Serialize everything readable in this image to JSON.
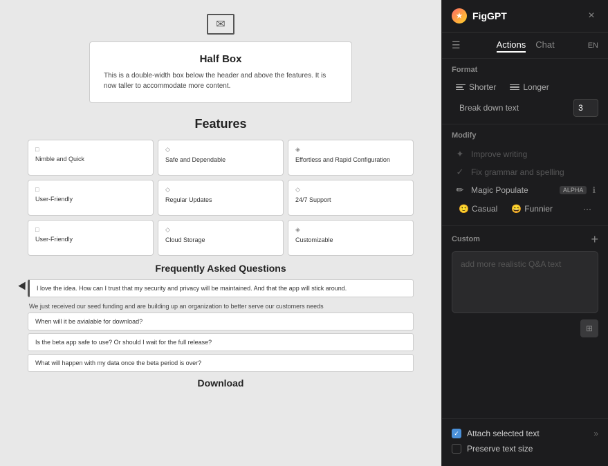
{
  "canvas": {
    "halfbox": {
      "title": "Half Box",
      "description": "This is a double-width box below the header and above the features.\nIt is now taller to accommodate more content."
    },
    "features": {
      "title": "Features",
      "cards": [
        {
          "icon": "□",
          "label": "Nimble and Quick"
        },
        {
          "icon": "◇",
          "label": "Safe and Dependable"
        },
        {
          "icon": "◈",
          "label": "Effortless and Rapid Configuration"
        },
        {
          "icon": "□",
          "label": "User-Friendly"
        },
        {
          "icon": "◇",
          "label": "Regular Updates"
        },
        {
          "icon": "◇",
          "label": "24/7 Support"
        },
        {
          "icon": "□",
          "label": "User-Friendly"
        },
        {
          "icon": "◇",
          "label": "Cloud Storage"
        },
        {
          "icon": "◈",
          "label": "Customizable"
        }
      ]
    },
    "faq": {
      "title": "Frequently Asked Questions",
      "plain_text": "We just received our seed funding and are building up an organization to better serve our customers needs",
      "items": [
        "I love the idea. How can I trust that my security and privacy will be maintained. And that the app will stick around.",
        "When will it be avialable for download?",
        "Is the beta app safe to use? Or should I wait for the full release?",
        "What will happen with my data once the beta period is over?"
      ]
    },
    "download": {
      "title": "Download"
    }
  },
  "sidebar": {
    "header": {
      "logo_text": "★",
      "title": "FigGPT",
      "close_label": "×"
    },
    "nav": {
      "actions_label": "Actions",
      "chat_label": "Chat",
      "lang_label": "EN"
    },
    "format": {
      "section_label": "Format",
      "shorter_label": "Shorter",
      "longer_label": "Longer",
      "break_down_label": "Break down text",
      "break_value": "3"
    },
    "modify": {
      "section_label": "Modify",
      "improve_label": "Improve writing",
      "grammar_label": "Fix grammar and spelling",
      "magic_label": "Magic Populate",
      "alpha_badge": "ALPHA",
      "casual_label": "Casual",
      "funnier_label": "Funnier"
    },
    "custom": {
      "section_label": "Custom",
      "add_label": "+",
      "placeholder": "add more realistic Q&A text"
    },
    "bottom": {
      "attach_label": "Attach selected text",
      "preserve_label": "Preserve text size",
      "attach_checked": true,
      "preserve_checked": false
    }
  }
}
